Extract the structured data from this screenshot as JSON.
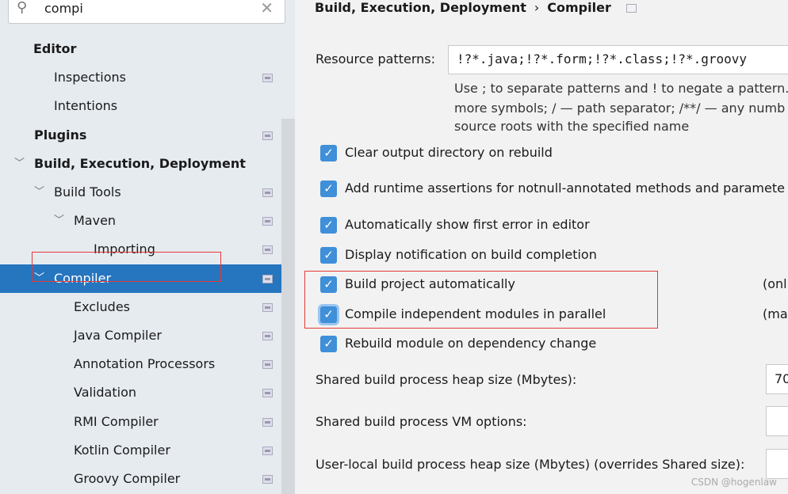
{
  "search": {
    "value": "compi",
    "icon": "search-icon",
    "clear_icon": "close-icon"
  },
  "tree": [
    {
      "label": "Editor",
      "bold": true,
      "indent": 42,
      "arrow": false,
      "page_icon": false
    },
    {
      "label": "Inspections",
      "indent": 68,
      "arrow": false,
      "page_icon": true
    },
    {
      "label": "Intentions",
      "indent": 68,
      "arrow": false,
      "page_icon": false
    },
    {
      "label": "Plugins",
      "bold": true,
      "indent": 43,
      "arrow": false,
      "page_icon": true
    },
    {
      "label": "Build, Execution, Deployment",
      "bold": true,
      "indent": 43,
      "arrow": true,
      "page_icon": false
    },
    {
      "label": "Build Tools",
      "indent": 68,
      "arrow": true,
      "page_icon": true
    },
    {
      "label": "Maven",
      "indent": 93,
      "arrow": true,
      "page_icon": true
    },
    {
      "label": "Importing",
      "indent": 118,
      "arrow": false,
      "page_icon": true
    },
    {
      "label": "Compiler",
      "indent": 68,
      "arrow": true,
      "page_icon": true,
      "selected": true
    },
    {
      "label": "Excludes",
      "indent": 93,
      "arrow": false,
      "page_icon": true
    },
    {
      "label": "Java Compiler",
      "indent": 93,
      "arrow": false,
      "page_icon": true
    },
    {
      "label": "Annotation Processors",
      "indent": 93,
      "arrow": false,
      "page_icon": true
    },
    {
      "label": "Validation",
      "indent": 93,
      "arrow": false,
      "page_icon": true
    },
    {
      "label": "RMI Compiler",
      "indent": 93,
      "arrow": false,
      "page_icon": true
    },
    {
      "label": "Kotlin Compiler",
      "indent": 93,
      "arrow": false,
      "page_icon": true
    },
    {
      "label": "Groovy Compiler",
      "indent": 93,
      "arrow": false,
      "page_icon": true
    }
  ],
  "breadcrumb": {
    "parent": "Build, Execution, Deployment",
    "separator": "›",
    "current": "Compiler"
  },
  "resource": {
    "label": "Resource patterns:",
    "value": "!?*.java;!?*.form;!?*.class;!?*.groovy",
    "help": [
      "Use ; to separate patterns and ! to negate a pattern.",
      "more symbols; / — path separator; /**/ — any numb",
      "source roots with the specified name"
    ]
  },
  "checkboxes": [
    {
      "label": "Clear output directory on rebuild",
      "checked": true
    },
    {
      "label": "Add runtime assertions for notnull-annotated methods and paramete",
      "checked": true
    },
    {
      "label": "Automatically show first error in editor",
      "checked": true
    },
    {
      "label": "Display notification on build completion",
      "checked": true
    },
    {
      "label": "Build project automatically",
      "checked": true,
      "note": "(onl"
    },
    {
      "label": "Compile independent modules in parallel",
      "checked": true,
      "note": "(ma",
      "focused": true
    },
    {
      "label": "Rebuild module on dependency change",
      "checked": true
    }
  ],
  "fields": [
    {
      "label": "Shared build process heap size (Mbytes):",
      "value": "70"
    },
    {
      "label": "Shared build process VM options:",
      "value": ""
    },
    {
      "label": "User-local build process heap size (Mbytes) (overrides Shared size):",
      "value": ""
    }
  ],
  "watermark": "CSDN @hogenlaw",
  "colors": {
    "selection": "#2675bf",
    "checkbox": "#3f8fd9",
    "highlight": "#e53935"
  }
}
